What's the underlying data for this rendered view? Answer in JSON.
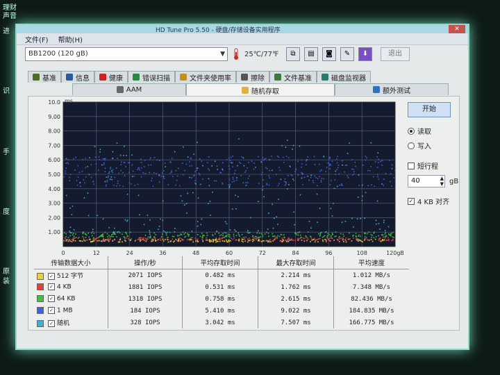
{
  "desktop_fragments": [
    "理财",
    "声音",
    "进",
    "识",
    "手",
    "度",
    "原",
    "装"
  ],
  "window": {
    "title": "HD Tune Pro 5.50 - 硬盘/存储设备实用程序",
    "menu": [
      "文件(F)",
      "帮助(H)"
    ],
    "drive": "BB1200 (120 gB)",
    "temperature": "25℃/77℉",
    "exit_label": "退出"
  },
  "tabs_row1": [
    {
      "label": "基准",
      "icon_color": "#4a6d2a"
    },
    {
      "label": "信息",
      "icon_color": "#2a5a9a"
    },
    {
      "label": "健康",
      "icon_color": "#d02020"
    },
    {
      "label": "错误扫描",
      "icon_color": "#2a8a40"
    },
    {
      "label": "文件夹使用率",
      "icon_color": "#c09020"
    },
    {
      "label": "擦除",
      "icon_color": "#555555"
    },
    {
      "label": "文件基准",
      "icon_color": "#3a7a3a"
    },
    {
      "label": "磁盘监视器",
      "icon_color": "#2a7a6a"
    }
  ],
  "tabs_row2": [
    {
      "label": "AAM",
      "icon_color": "#666666"
    },
    {
      "label": "随机存取",
      "icon_color": "#e0b040",
      "active": true
    },
    {
      "label": "额外测试",
      "icon_color": "#3070c0"
    }
  ],
  "chart_data": {
    "type": "scatter",
    "y_unit": "ms",
    "x_unit": "gB",
    "y_ticks": [
      "10.0",
      "9.00",
      "8.00",
      "7.00",
      "6.00",
      "5.00",
      "4.00",
      "3.00",
      "2.00",
      "1.00"
    ],
    "x_ticks": [
      "0",
      "12",
      "24",
      "36",
      "48",
      "60",
      "72",
      "84",
      "96",
      "108",
      "120gB"
    ],
    "ylim": [
      0,
      10
    ],
    "xlim": [
      0,
      120
    ],
    "grid": true,
    "series": [
      {
        "name": "512 字节",
        "color": "#e6d040",
        "band": [
          0.35,
          0.55
        ]
      },
      {
        "name": "4 KB",
        "color": "#e04040",
        "band": [
          0.45,
          0.65
        ]
      },
      {
        "name": "64 KB",
        "color": "#40c040",
        "band": [
          0.65,
          1.05
        ]
      },
      {
        "name": "1 MB",
        "color": "#4060e0",
        "band": [
          4.2,
          6.3
        ]
      },
      {
        "name": "随机",
        "color": "#40b0d0",
        "band": [
          1.0,
          7.5
        ]
      }
    ]
  },
  "side_panel": {
    "start_label": "开始",
    "read_label": "读取",
    "write_label": "写入",
    "short_stroke_label": "短行程",
    "short_stroke_value": "40",
    "short_stroke_unit": "gB",
    "align_label": "4 KB 对齐"
  },
  "results": {
    "headers": [
      "传输数据大小",
      "操作/秒",
      "平均存取时间",
      "最大存取时间",
      "平均速度"
    ],
    "rows": [
      {
        "size": "512 字节",
        "color": "#e6d040",
        "iops": "2071 IOPS",
        "avg": "0.482 ms",
        "max": "2.214 ms",
        "speed": "1.012 MB/s"
      },
      {
        "size": "4 KB",
        "color": "#e04040",
        "iops": "1881 IOPS",
        "avg": "0.531 ms",
        "max": "1.762 ms",
        "speed": "7.348 MB/s"
      },
      {
        "size": "64 KB",
        "color": "#40c040",
        "iops": "1318 IOPS",
        "avg": "0.758 ms",
        "max": "2.615 ms",
        "speed": "82.436 MB/s"
      },
      {
        "size": "1 MB",
        "color": "#4060e0",
        "iops": "184 IOPS",
        "avg": "5.410 ms",
        "max": "9.022 ms",
        "speed": "184.835 MB/s"
      },
      {
        "size": "随机",
        "color": "#40b0d0",
        "iops": "328 IOPS",
        "avg": "3.042 ms",
        "max": "7.507 ms",
        "speed": "166.775 MB/s"
      }
    ]
  }
}
